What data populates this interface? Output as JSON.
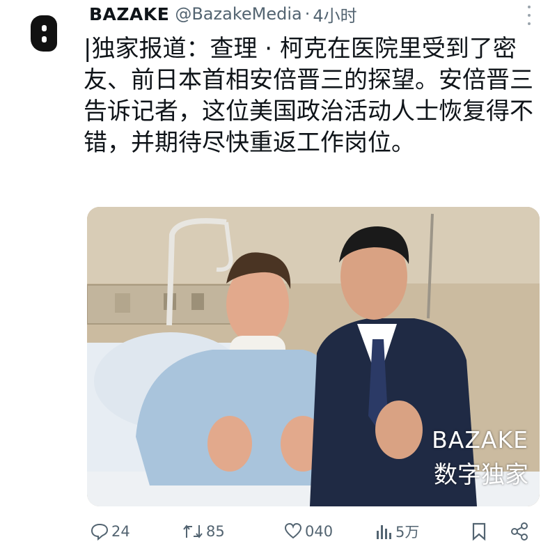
{
  "author": {
    "display_name": "BAZAKE",
    "handle": "@BazakeMedia",
    "separator": "·",
    "time": "4小时"
  },
  "tweet": {
    "text": "|独家报道：查理 · 柯克在医院里受到了密友、前日本首相安倍晋三的探望。安倍晋三告诉记者，这位美国政治活动人士恢复得不错，并期待尽快重返工作岗位。"
  },
  "media": {
    "watermark_line1": "BAZAKE",
    "watermark_line2": "数字独家",
    "colors": {
      "wall": "#cbbba0",
      "gown": "#a9c4dc",
      "suit": "#1f2a44"
    }
  },
  "actions": {
    "reply_count": "24",
    "retweet_count": "85",
    "like_count": "040",
    "view_count": "5万"
  },
  "icons": [
    "more-icon",
    "reply-icon",
    "retweet-icon",
    "like-icon",
    "views-icon",
    "bookmark-icon",
    "share-icon"
  ],
  "colors": {
    "text": "#0f1419",
    "muted": "#536471"
  }
}
